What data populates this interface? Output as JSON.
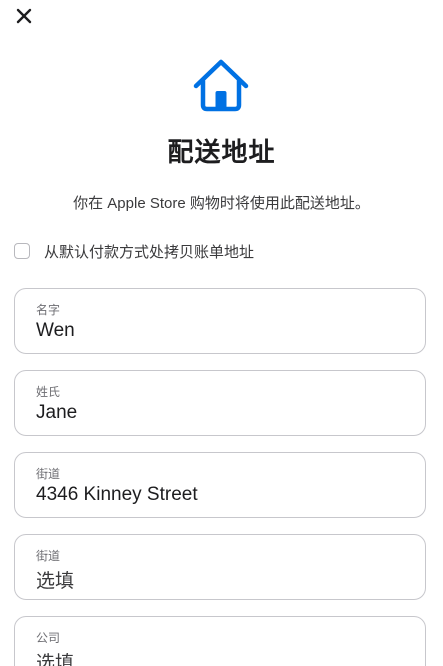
{
  "header": {
    "close_icon": "close-icon",
    "title": "配送地址",
    "subtitle": "你在 Apple Store 购物时将使用此配送地址。"
  },
  "hero_icon": "house-icon",
  "accent_color": "#0071e3",
  "copy_billing": {
    "label": "从默认付款方式处拷贝账单地址",
    "checked": false
  },
  "fields": [
    {
      "label": "名字",
      "value": "Wen",
      "is_placeholder": false
    },
    {
      "label": "姓氏",
      "value": "Jane",
      "is_placeholder": false
    },
    {
      "label": "街道",
      "value": "4346 Kinney Street",
      "is_placeholder": false
    },
    {
      "label": "街道",
      "value": "选填",
      "is_placeholder": true
    },
    {
      "label": "公司",
      "value": "选填",
      "is_placeholder": true
    }
  ]
}
